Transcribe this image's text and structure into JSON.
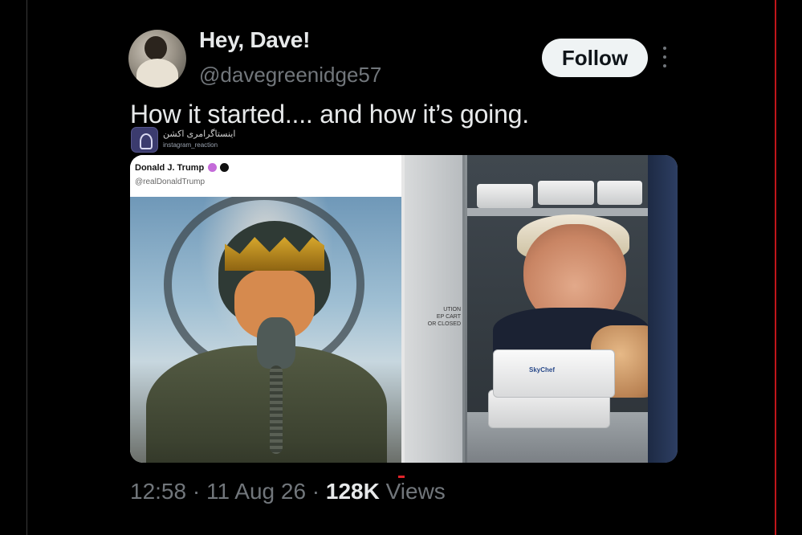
{
  "tweet": {
    "author": {
      "display_name": "Hey, Dave!",
      "handle": "@davegreenidge57"
    },
    "follow_label": "Follow",
    "text": "How it started.... and how it’s going.",
    "watermark": {
      "title": "اینستاگرامری اکشن",
      "subtitle": "instagram_reaction"
    },
    "embedded_post": {
      "name": "Donald J. Trump",
      "handle": "@realDonaldTrump"
    },
    "cabinet_notice": "UTION\nEP CART\nOR CLOSED",
    "meal_brand": "SkyChef",
    "meta": {
      "time": "12:58",
      "separator": "·",
      "date": "11 Aug 26",
      "views_count": "128K",
      "views_label": "Views"
    }
  },
  "icons": {
    "more": "more-options-icon",
    "verified": "verified-badge-icon",
    "flag": "affiliation-icon"
  },
  "colors": {
    "background": "#000000",
    "primary_text": "#e7e9ea",
    "secondary_text": "#71767b",
    "follow_bg": "#eff3f4",
    "right_rail": "#c0161a"
  }
}
